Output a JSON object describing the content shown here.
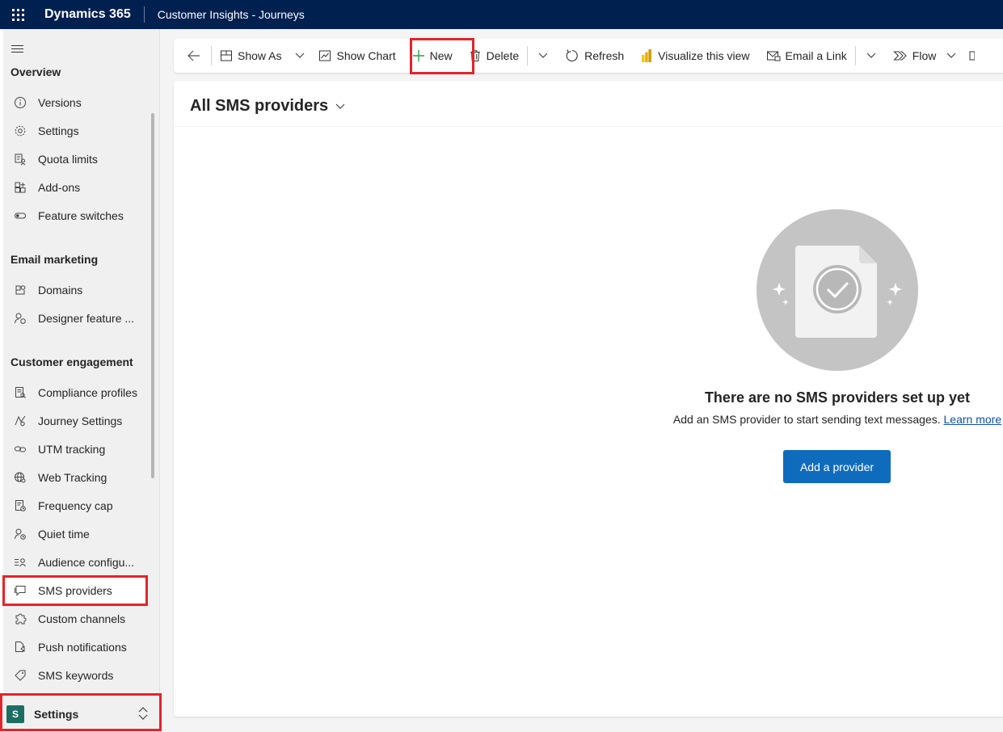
{
  "topbar": {
    "brand": "Dynamics 365",
    "app_name": "Customer Insights - Journeys"
  },
  "sidebar": {
    "groups": [
      {
        "title": "Overview",
        "items": [
          {
            "label": "Versions",
            "icon": "info-icon"
          },
          {
            "label": "Settings",
            "icon": "gear-icon"
          },
          {
            "label": "Quota limits",
            "icon": "quota-icon"
          },
          {
            "label": "Add-ons",
            "icon": "add-ons-icon"
          },
          {
            "label": "Feature switches",
            "icon": "toggle-icon"
          }
        ]
      },
      {
        "title": "Email marketing",
        "items": [
          {
            "label": "Domains",
            "icon": "domains-icon"
          },
          {
            "label": "Designer feature ...",
            "icon": "designer-icon"
          }
        ]
      },
      {
        "title": "Customer engagement",
        "items": [
          {
            "label": "Compliance profiles",
            "icon": "compliance-icon"
          },
          {
            "label": "Journey Settings",
            "icon": "journey-icon"
          },
          {
            "label": "UTM tracking",
            "icon": "link-icon"
          },
          {
            "label": "Web Tracking",
            "icon": "globe-icon"
          },
          {
            "label": "Frequency cap",
            "icon": "frequency-icon"
          },
          {
            "label": "Quiet time",
            "icon": "quiet-time-icon"
          },
          {
            "label": "Audience configu...",
            "icon": "audience-icon"
          },
          {
            "label": "SMS providers",
            "icon": "sms-icon",
            "selected": true
          },
          {
            "label": "Custom channels",
            "icon": "puzzle-icon"
          },
          {
            "label": "Push notifications",
            "icon": "push-icon"
          },
          {
            "label": "SMS keywords",
            "icon": "tag-icon"
          }
        ]
      }
    ],
    "area": {
      "badge": "S",
      "label": "Settings"
    }
  },
  "toolbar": {
    "show_as": "Show As",
    "show_chart": "Show Chart",
    "new": "New",
    "delete": "Delete",
    "refresh": "Refresh",
    "visualize": "Visualize this view",
    "email_link": "Email a Link",
    "flow": "Flow"
  },
  "view": {
    "title": "All SMS providers"
  },
  "empty_state": {
    "title": "There are no SMS providers set up yet",
    "description": "Add an SMS provider to start sending text messages.",
    "learn_more": "Learn more",
    "button": "Add a provider"
  },
  "colors": {
    "topbar": "#002050",
    "accent": "#0f6cbd",
    "highlight": "#e3242b",
    "area_badge": "#1c6e63",
    "new_plus": "#2e9e44"
  }
}
